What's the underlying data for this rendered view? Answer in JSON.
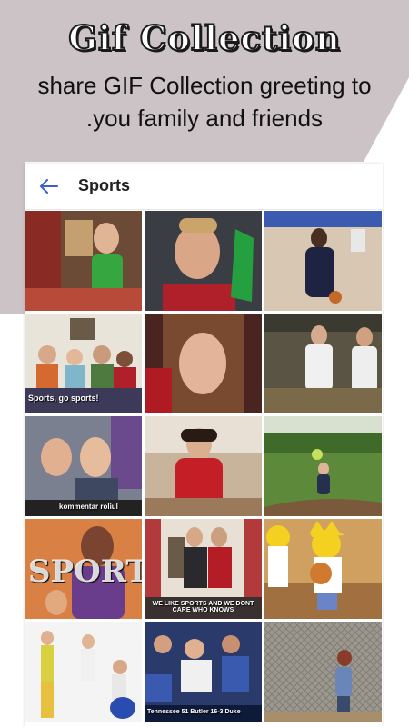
{
  "promo": {
    "title": "Gif Collection",
    "subtitle_line1": "share GIF Collection greeting to",
    "subtitle_line2": ".you family and friends"
  },
  "toolbar": {
    "back_icon": "arrow-left-icon",
    "title": "Sports"
  },
  "colors": {
    "background_shape": "#cbc3c6",
    "accent": "#3a5fd0"
  },
  "gifs": [
    {
      "subject": "man-green-recycle-shirt"
    },
    {
      "subject": "smiling-man-green-foam-finger"
    },
    {
      "subject": "basketball-player-dribbling"
    },
    {
      "subject": "family-on-couch",
      "caption": "Sports, go sports!"
    },
    {
      "subject": "woman-close-up"
    },
    {
      "subject": "baseball-dugout-players"
    },
    {
      "subject": "fan-yelling-in-stands",
      "caption": "kommentar roliul"
    },
    {
      "subject": "woman-red-tracksuit-dancing"
    },
    {
      "subject": "toddler-catching-frisbee-park"
    },
    {
      "subject": "sports-player-18",
      "caption": "SPORTS"
    },
    {
      "subject": "players-21-on-tv",
      "caption": "WE LIKE SPORTS AND WE DONT CARE WHO KNOWS"
    },
    {
      "subject": "simpsons-basketball"
    },
    {
      "subject": "retro-exercise-people"
    },
    {
      "subject": "crowd-in-stadium",
      "caption": "Tennessee 51  Butler 16-3  Duke"
    },
    {
      "subject": "kid-hitting-fence"
    }
  ]
}
